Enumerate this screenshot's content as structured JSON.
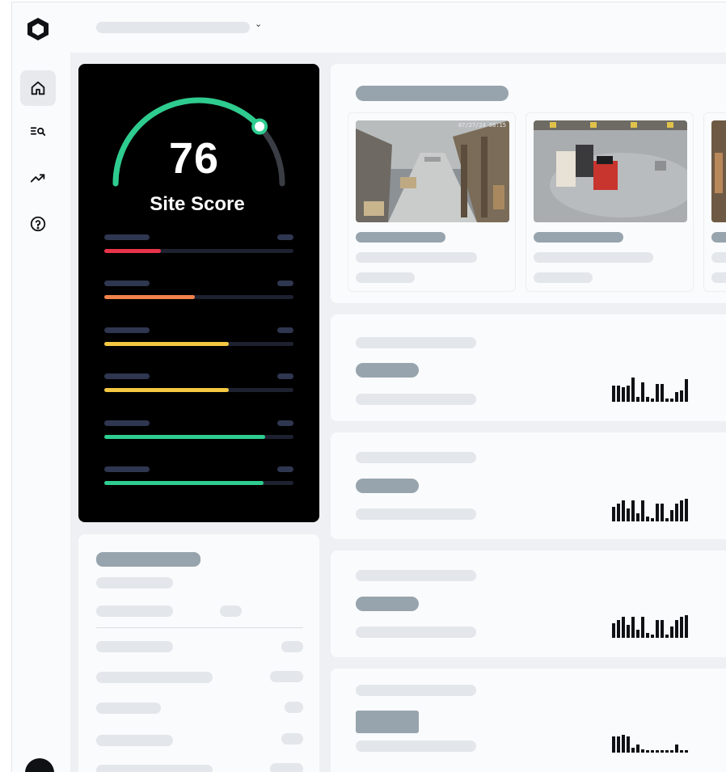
{
  "score_card": {
    "score": "76",
    "label": "Site Score",
    "gauge_fraction": 0.76,
    "metrics": [
      {
        "fraction": 0.3,
        "color": "#e8334a"
      },
      {
        "fraction": 0.48,
        "color": "#f0824a"
      },
      {
        "fraction": 0.66,
        "color": "#f5c842"
      },
      {
        "fraction": 0.66,
        "color": "#f5c842"
      },
      {
        "fraction": 0.85,
        "color": "#2ecc8f"
      },
      {
        "fraction": 0.84,
        "color": "#2ecc8f"
      }
    ]
  },
  "cameras": [
    {
      "timestamp": "07/27/24 08:15"
    },
    {
      "timestamp": ""
    },
    {
      "timestamp": ""
    }
  ],
  "colors": {
    "accent": "#2ecc8f",
    "gauge_track": "#3a3d44",
    "skeleton_light": "#e3e6ea",
    "skeleton_dark": "#97a4ad"
  },
  "icons": [
    "logo-icon",
    "chevron-down-icon",
    "home-icon",
    "search-list-icon",
    "trending-up-icon",
    "help-icon"
  ]
}
